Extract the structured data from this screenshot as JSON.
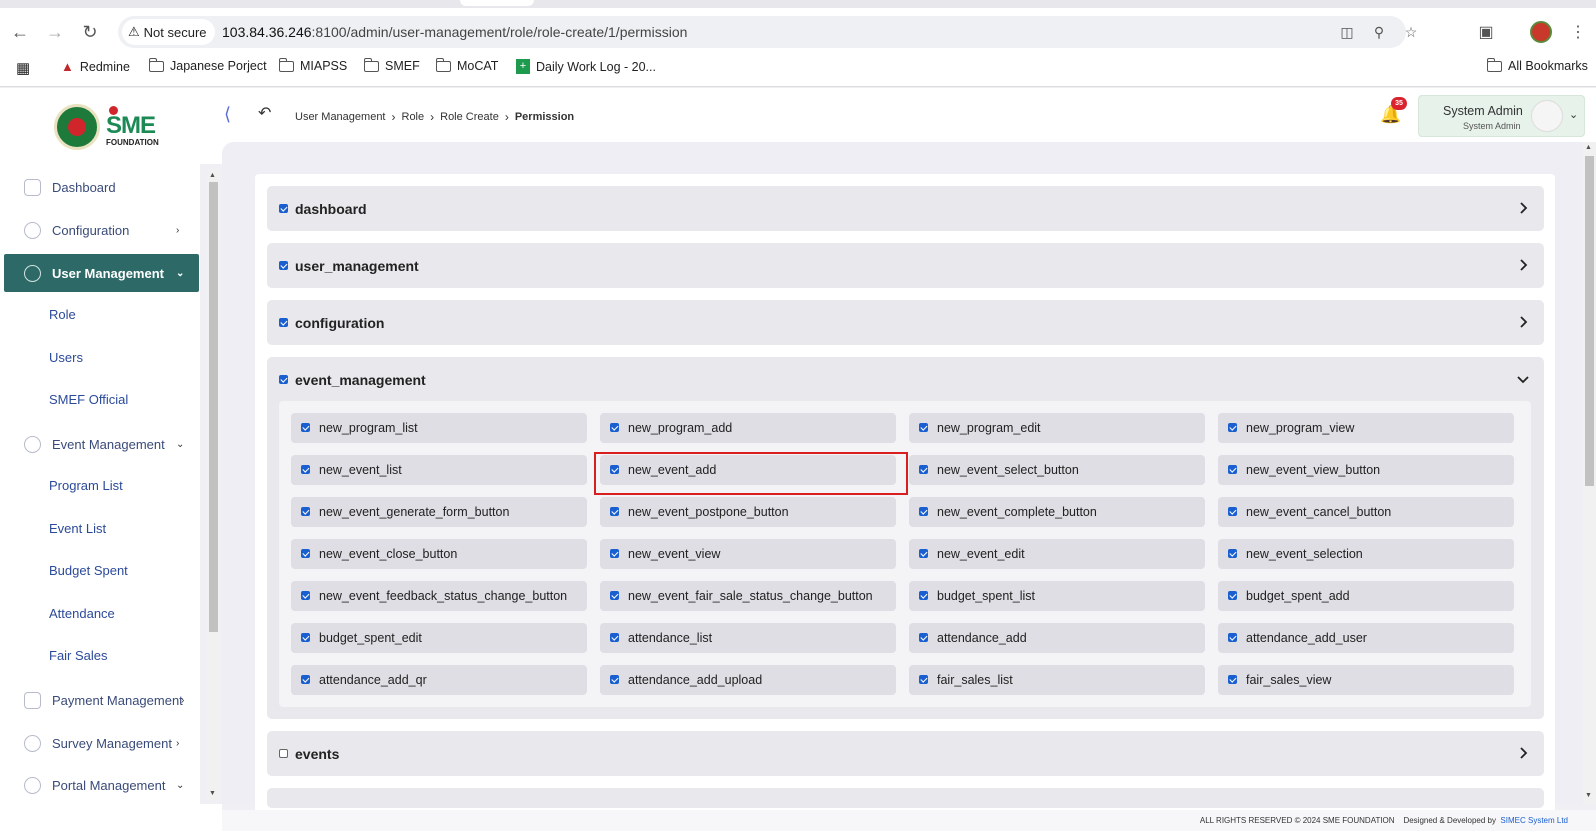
{
  "browser": {
    "security_label": "Not secure",
    "url_host": "103.84.36.246",
    "url_rest": ":8100/admin/user-management/role/role-create/1/permission",
    "bookmarks": [
      "Redmine",
      "Japanese Porject",
      "MIAPSS",
      "SMEF",
      "MoCAT",
      "Daily Work Log - 20...",
      "All Bookmarks"
    ]
  },
  "app": {
    "logo_text": "SME",
    "logo_subtext": "FOUNDATION",
    "breadcrumb": [
      "User Management",
      "Role",
      "Role Create",
      "Permission"
    ],
    "notification_count": "35",
    "user": {
      "name": "System Admin",
      "role": "System Admin"
    }
  },
  "sidebar": {
    "items": [
      {
        "label": "Dashboard"
      },
      {
        "label": "Configuration"
      },
      {
        "label": "User Management"
      },
      {
        "label": "Event Management"
      },
      {
        "label": "Payment Management"
      },
      {
        "label": "Survey Management"
      },
      {
        "label": "Portal Management"
      }
    ],
    "user_mgmt_sub": [
      "Role",
      "Users",
      "SMEF Official"
    ],
    "event_mgmt_sub": [
      "Program List",
      "Event List",
      "Budget Spent",
      "Attendance",
      "Fair Sales"
    ]
  },
  "groups": [
    {
      "name": "dashboard",
      "checked": true,
      "expanded": false
    },
    {
      "name": "user_management",
      "checked": true,
      "expanded": false
    },
    {
      "name": "configuration",
      "checked": true,
      "expanded": false
    },
    {
      "name": "event_management",
      "checked": true,
      "expanded": true
    },
    {
      "name": "events",
      "checked": false,
      "expanded": false
    }
  ],
  "event_permissions": [
    [
      "new_program_list",
      "new_program_add",
      "new_program_edit",
      "new_program_view"
    ],
    [
      "new_event_list",
      "new_event_add",
      "new_event_select_button",
      "new_event_view_button"
    ],
    [
      "new_event_generate_form_button",
      "new_event_postpone_button",
      "new_event_complete_button",
      "new_event_cancel_button"
    ],
    [
      "new_event_close_button",
      "new_event_view",
      "new_event_edit",
      "new_event_selection"
    ],
    [
      "new_event_feedback_status_change_button",
      "new_event_fair_sale_status_change_button",
      "budget_spent_list",
      "budget_spent_add"
    ],
    [
      "budget_spent_edit",
      "attendance_list",
      "attendance_add",
      "attendance_add_user"
    ],
    [
      "attendance_add_qr",
      "attendance_add_upload",
      "fair_sales_list",
      "fair_sales_view"
    ]
  ],
  "footer": {
    "rights": "ALL RIGHTS RESERVED © 2024 SME FOUNDATION",
    "designed_by": "Designed & Developed by",
    "company": "SIMEC System Ltd"
  },
  "colors": {
    "sidebar_active": "#2d6a67",
    "checkbox": "#1a5fd0",
    "highlight": "#d81e1e"
  }
}
